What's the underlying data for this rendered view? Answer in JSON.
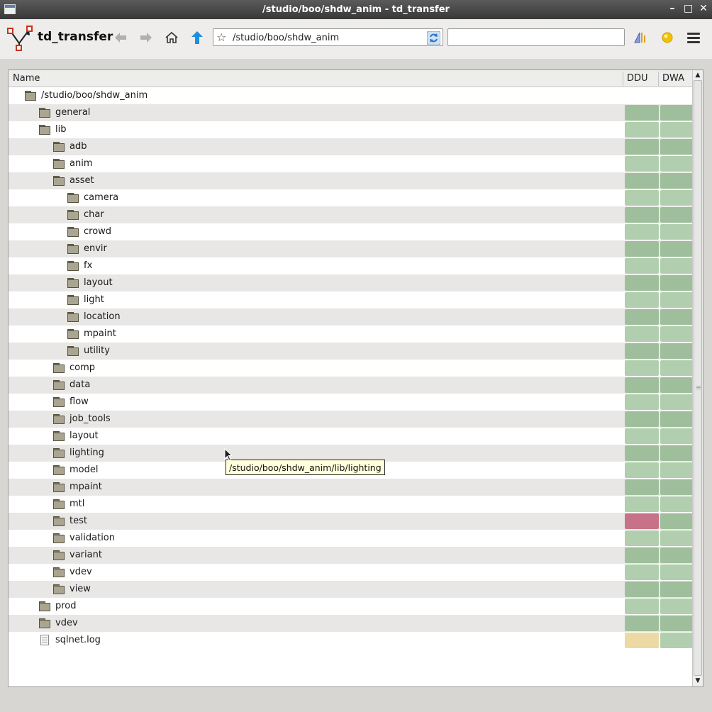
{
  "window": {
    "title": "/studio/boo/shdw_anim - td_transfer",
    "controls": [
      "minimize-icon",
      "maximize-icon",
      "close-icon"
    ]
  },
  "toolbar": {
    "app_name": "td_transfer",
    "url": "/studio/boo/shdw_anim",
    "search_value": "",
    "buttons": [
      "back-arrow-icon",
      "forward-arrow-icon",
      "home-icon",
      "up-arrow-icon",
      "reload-icon",
      "filter-icon",
      "status-light-icon",
      "menu-icon"
    ]
  },
  "colors": {
    "ok_dark": "#9fbf9c",
    "ok_light": "#b1cfae",
    "error": "#c87289",
    "warning": "#ecd9a3"
  },
  "table": {
    "columns": [
      "Name",
      "DDU",
      "DWA"
    ],
    "rows": [
      {
        "name": "/studio/boo/shdw_anim",
        "type": "folder",
        "depth": 0,
        "ddu": "",
        "dwa": ""
      },
      {
        "name": "general",
        "type": "folder",
        "depth": 1,
        "ddu": "ok",
        "dwa": "ok"
      },
      {
        "name": "lib",
        "type": "folder",
        "depth": 1,
        "ddu": "ok",
        "dwa": "ok"
      },
      {
        "name": "adb",
        "type": "folder",
        "depth": 2,
        "ddu": "ok",
        "dwa": "ok"
      },
      {
        "name": "anim",
        "type": "folder",
        "depth": 2,
        "ddu": "ok",
        "dwa": "ok"
      },
      {
        "name": "asset",
        "type": "folder",
        "depth": 2,
        "ddu": "ok",
        "dwa": "ok"
      },
      {
        "name": "camera",
        "type": "folder",
        "depth": 3,
        "ddu": "ok",
        "dwa": "ok"
      },
      {
        "name": "char",
        "type": "folder",
        "depth": 3,
        "ddu": "ok",
        "dwa": "ok"
      },
      {
        "name": "crowd",
        "type": "folder",
        "depth": 3,
        "ddu": "ok",
        "dwa": "ok"
      },
      {
        "name": "envir",
        "type": "folder",
        "depth": 3,
        "ddu": "ok",
        "dwa": "ok"
      },
      {
        "name": "fx",
        "type": "folder",
        "depth": 3,
        "ddu": "ok",
        "dwa": "ok"
      },
      {
        "name": "layout",
        "type": "folder",
        "depth": 3,
        "ddu": "ok",
        "dwa": "ok"
      },
      {
        "name": "light",
        "type": "folder",
        "depth": 3,
        "ddu": "ok",
        "dwa": "ok"
      },
      {
        "name": "location",
        "type": "folder",
        "depth": 3,
        "ddu": "ok",
        "dwa": "ok"
      },
      {
        "name": "mpaint",
        "type": "folder",
        "depth": 3,
        "ddu": "ok",
        "dwa": "ok"
      },
      {
        "name": "utility",
        "type": "folder",
        "depth": 3,
        "ddu": "ok",
        "dwa": "ok"
      },
      {
        "name": "comp",
        "type": "folder",
        "depth": 2,
        "ddu": "ok",
        "dwa": "ok"
      },
      {
        "name": "data",
        "type": "folder",
        "depth": 2,
        "ddu": "ok",
        "dwa": "ok"
      },
      {
        "name": "flow",
        "type": "folder",
        "depth": 2,
        "ddu": "ok",
        "dwa": "ok"
      },
      {
        "name": "job_tools",
        "type": "folder",
        "depth": 2,
        "ddu": "ok",
        "dwa": "ok"
      },
      {
        "name": "layout",
        "type": "folder",
        "depth": 2,
        "ddu": "ok",
        "dwa": "ok"
      },
      {
        "name": "lighting",
        "type": "folder",
        "depth": 2,
        "ddu": "ok",
        "dwa": "ok"
      },
      {
        "name": "model",
        "type": "folder",
        "depth": 2,
        "ddu": "ok",
        "dwa": "ok"
      },
      {
        "name": "mpaint",
        "type": "folder",
        "depth": 2,
        "ddu": "ok",
        "dwa": "ok"
      },
      {
        "name": "mtl",
        "type": "folder",
        "depth": 2,
        "ddu": "ok",
        "dwa": "ok"
      },
      {
        "name": "test",
        "type": "folder",
        "depth": 2,
        "ddu": "error",
        "dwa": "ok"
      },
      {
        "name": "validation",
        "type": "folder",
        "depth": 2,
        "ddu": "ok",
        "dwa": "ok"
      },
      {
        "name": "variant",
        "type": "folder",
        "depth": 2,
        "ddu": "ok",
        "dwa": "ok"
      },
      {
        "name": "vdev",
        "type": "folder",
        "depth": 2,
        "ddu": "ok",
        "dwa": "ok"
      },
      {
        "name": "view",
        "type": "folder",
        "depth": 2,
        "ddu": "ok",
        "dwa": "ok"
      },
      {
        "name": "prod",
        "type": "folder",
        "depth": 1,
        "ddu": "ok",
        "dwa": "ok"
      },
      {
        "name": "vdev",
        "type": "folder",
        "depth": 1,
        "ddu": "ok",
        "dwa": "ok"
      },
      {
        "name": "sqlnet.log",
        "type": "file",
        "depth": 1,
        "ddu": "warning",
        "dwa": "ok"
      }
    ]
  },
  "tooltip": {
    "text": "/studio/boo/shdw_anim/lib/lighting"
  }
}
